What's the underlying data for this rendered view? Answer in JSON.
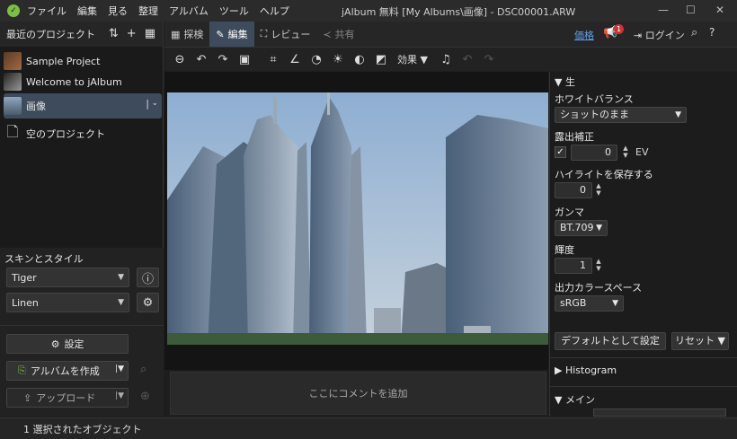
{
  "menu": [
    "ファイル",
    "編集",
    "見る",
    "整理",
    "アルバム",
    "ツール",
    "ヘルプ"
  ],
  "window_title": "jAlbum 無料 [My Albums\\画像] - DSC00001.ARW",
  "projects": {
    "header": "最近のプロジェクト",
    "items": [
      "Sample Project",
      "Welcome to jAlbum",
      "画像",
      "空のプロジェクト"
    ]
  },
  "skin": {
    "header": "スキンとスタイル",
    "skin_value": "Tiger",
    "style_value": "Linen"
  },
  "buttons": {
    "settings": "設定",
    "make_album": "アルバムを作成",
    "upload": "アップロード"
  },
  "tabs": {
    "explore": "探検",
    "edit": "編集",
    "review": "レビュー",
    "share": "共有"
  },
  "account": {
    "price": "価格",
    "notif_count": "1",
    "login": "ログイン"
  },
  "edit_toolbar": {
    "effects": "効果"
  },
  "comment_placeholder": "ここにコメントを追加",
  "raw": {
    "section": "生",
    "wb_label": "ホワイトバランス",
    "wb_value": "ショットのまま",
    "exposure_label": "露出補正",
    "exposure_value": "0",
    "exposure_unit": "EV",
    "highlight_label": "ハイライトを保存する",
    "highlight_value": "0",
    "gamma_label": "ガンマ",
    "gamma_value": "BT.709",
    "brightness_label": "輝度",
    "brightness_value": "1",
    "colorspace_label": "出力カラースペース",
    "colorspace_value": "sRGB",
    "default_btn": "デフォルトとして設定",
    "reset_btn": "リセット"
  },
  "histogram": "Histogram",
  "main_section": "メイン",
  "status": "1 選択されたオブジェクト"
}
